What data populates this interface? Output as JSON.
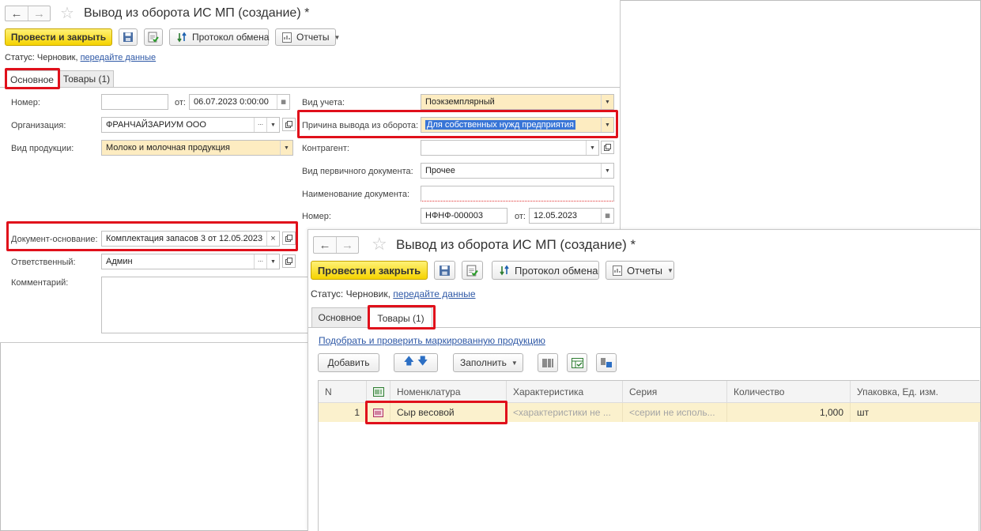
{
  "window1": {
    "title": "Вывод из оборота ИС МП (создание) *",
    "toolbar": {
      "post_close": "Провести и закрыть",
      "exchange_log": "Протокол обмена",
      "reports": "Отчеты"
    },
    "status": {
      "label": "Статус:",
      "value": "Черновик,",
      "link": "передайте данные"
    },
    "tabs": [
      "Основное",
      "Товары (1)"
    ],
    "form": {
      "number_label": "Номер:",
      "number_value": "",
      "from_label": "от:",
      "date_value": "06.07.2023  0:00:00",
      "org_label": "Организация:",
      "org_value": "ФРАНЧАЙЗАРИУМ ООО",
      "product_type_label": "Вид продукции:",
      "product_type_value": "Молоко и молочная продукция",
      "base_doc_label": "Документ-основание:",
      "base_doc_value": "Комплектация запасов 3 от 12.05.2023",
      "responsible_label": "Ответственный:",
      "responsible_value": "Админ",
      "comment_label": "Комментарий:",
      "comment_value": "",
      "accounting_label": "Вид учета:",
      "accounting_value": "Поэкземплярный",
      "reason_label": "Причина вывода из оборота:",
      "reason_value": "Для собственных нужд предприятия",
      "counterparty_label": "Контрагент:",
      "counterparty_value": "",
      "primary_doc_label": "Вид первичного документа:",
      "primary_doc_value": "Прочее",
      "doc_name_label": "Наименование документа:",
      "doc_name_value": "",
      "doc_number_label": "Номер:",
      "doc_number_value": "НФНФ-000003",
      "doc_from_label": "от:",
      "doc_date_value": "12.05.2023"
    }
  },
  "window2": {
    "title": "Вывод из оборота ИС МП (создание) *",
    "toolbar": {
      "post_close": "Провести и закрыть",
      "exchange_log": "Протокол обмена",
      "reports": "Отчеты"
    },
    "status": {
      "label": "Статус:",
      "value": "Черновик,",
      "link": "передайте данные"
    },
    "tabs": [
      "Основное",
      "Товары (1)"
    ],
    "pick_link": "Подобрать и проверить маркированную продукцию",
    "add_button": "Добавить",
    "fill_button": "Заполнить",
    "table": {
      "columns": [
        "N",
        "",
        "Номенклатура",
        "Характеристика",
        "Серия",
        "Количество",
        "Упаковка, Ед. изм."
      ],
      "rows": [
        {
          "n": "1",
          "name": "Сыр весовой",
          "characteristic": "<характеристики не ...",
          "series": "<серии не исполь...",
          "quantity": "1,000",
          "unit": "шт"
        }
      ]
    }
  },
  "colors": {
    "accent_yellow": "#f5d300",
    "highlight_red": "#e0101b",
    "link_blue": "#2e58a6",
    "row_yellow": "#fbf1cd",
    "field_yellow": "#fdecc1"
  }
}
